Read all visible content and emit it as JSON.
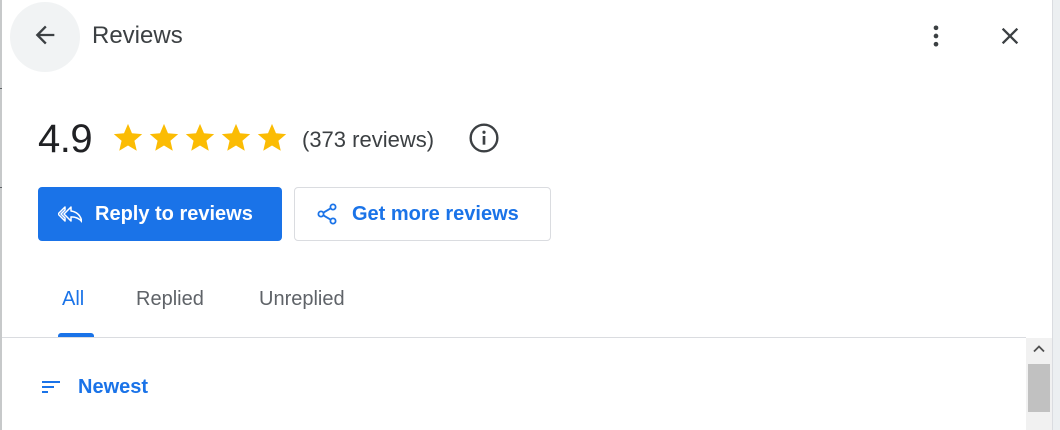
{
  "header": {
    "title": "Reviews",
    "back_icon": "arrow-back-icon",
    "more_icon": "more-vert-icon",
    "close_icon": "close-icon"
  },
  "rating": {
    "value": "4.9",
    "stars_filled": 5,
    "stars_total": 5,
    "count_text": "(373 reviews)",
    "info_icon": "info-icon"
  },
  "actions": {
    "reply_label": "Reply to reviews",
    "reply_icon": "reply-all-icon",
    "get_more_label": "Get more reviews",
    "get_more_icon": "share-icon"
  },
  "tabs": [
    {
      "label": "All",
      "active": true
    },
    {
      "label": "Replied",
      "active": false
    },
    {
      "label": "Unreplied",
      "active": false
    }
  ],
  "sort": {
    "label": "Newest",
    "icon": "sort-icon"
  },
  "colors": {
    "accent": "#1a73e8",
    "star": "#fbbc04",
    "text": "#202124",
    "muted": "#5f6368",
    "divider": "#dadce0"
  }
}
